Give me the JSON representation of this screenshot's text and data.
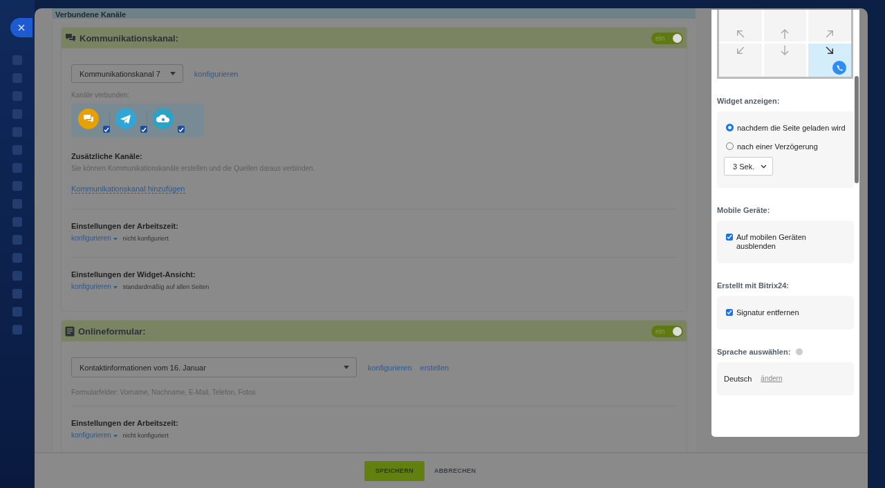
{
  "header": {
    "title": "Verbundene Kanäle"
  },
  "sections": [
    {
      "kind": "channel",
      "title": "Kommunikationskanal:",
      "toggle": {
        "label": "ein",
        "on": true
      },
      "select": "Kommunikationskanal 7",
      "links": [
        "konfigurieren"
      ],
      "connected_label": "Kanäle verbunden:",
      "connected": [
        {
          "kind": "chat",
          "color": "#e6a000",
          "checked": true
        },
        {
          "kind": "telegram",
          "color": "#2fa6d6",
          "checked": true
        },
        {
          "kind": "cloud",
          "color": "#2aa3c8",
          "checked": true
        }
      ],
      "extra": {
        "title": "Zusätzliche Kanäle:",
        "text": "Sie können Kommunikationskanäle erstellen und die Quellen daraus verbinden.",
        "link": "Kommunikationskanal hinzufügen"
      },
      "settings": [
        {
          "title": "Einstellungen der Arbeitszeit:",
          "link": "konfigurieren",
          "note": "nicht konfiguriert"
        },
        {
          "title": "Einstellungen der Widget-Ansicht:",
          "link": "konfigurieren",
          "note": "standardmäßig auf allen Seiten"
        }
      ]
    },
    {
      "kind": "form",
      "title": "Onlineformular:",
      "toggle": {
        "label": "ein",
        "on": true
      },
      "select": "Kontaktinformationen vom 16. Januar",
      "links": [
        "konfigurieren",
        "erstellen"
      ],
      "fields_note": "Formularfelder: Vorname, Nachname, E-Mail, Telefon, Fotos",
      "settings": [
        {
          "title": "Einstellungen der Arbeitszeit:",
          "link": "konfigurieren",
          "note": "nicht konfiguriert"
        }
      ]
    }
  ],
  "widget": {
    "position_cells": [
      {
        "kind": "up-left",
        "selected": false
      },
      {
        "kind": "up",
        "selected": false
      },
      {
        "kind": "up-right",
        "selected": false
      },
      {
        "kind": "down-left",
        "selected": false
      },
      {
        "kind": "down",
        "selected": false
      },
      {
        "kind": "down-right",
        "selected": true
      }
    ],
    "show": {
      "title": "Widget anzeigen:",
      "options": [
        {
          "label": "nachdem die Seite geladen wird",
          "selected": true
        },
        {
          "label": "nach einer Verzögerung",
          "selected": false
        }
      ],
      "delay": "3 Sek."
    },
    "mobile": {
      "title": "Mobile Geräte:",
      "label": "Auf mobilen Geräten ausblenden",
      "checked": true
    },
    "branding": {
      "title": "Erstellt mit Bitrix24:",
      "label": "Signatur entfernen",
      "checked": true
    },
    "language": {
      "title": "Sprache auswählen:",
      "value": "Deutsch",
      "link": "ändern"
    }
  },
  "buttons": [
    {
      "label": "SPEICHERN",
      "kind": "primary"
    },
    {
      "label": "ABBRECHEN",
      "kind": "secondary"
    }
  ]
}
